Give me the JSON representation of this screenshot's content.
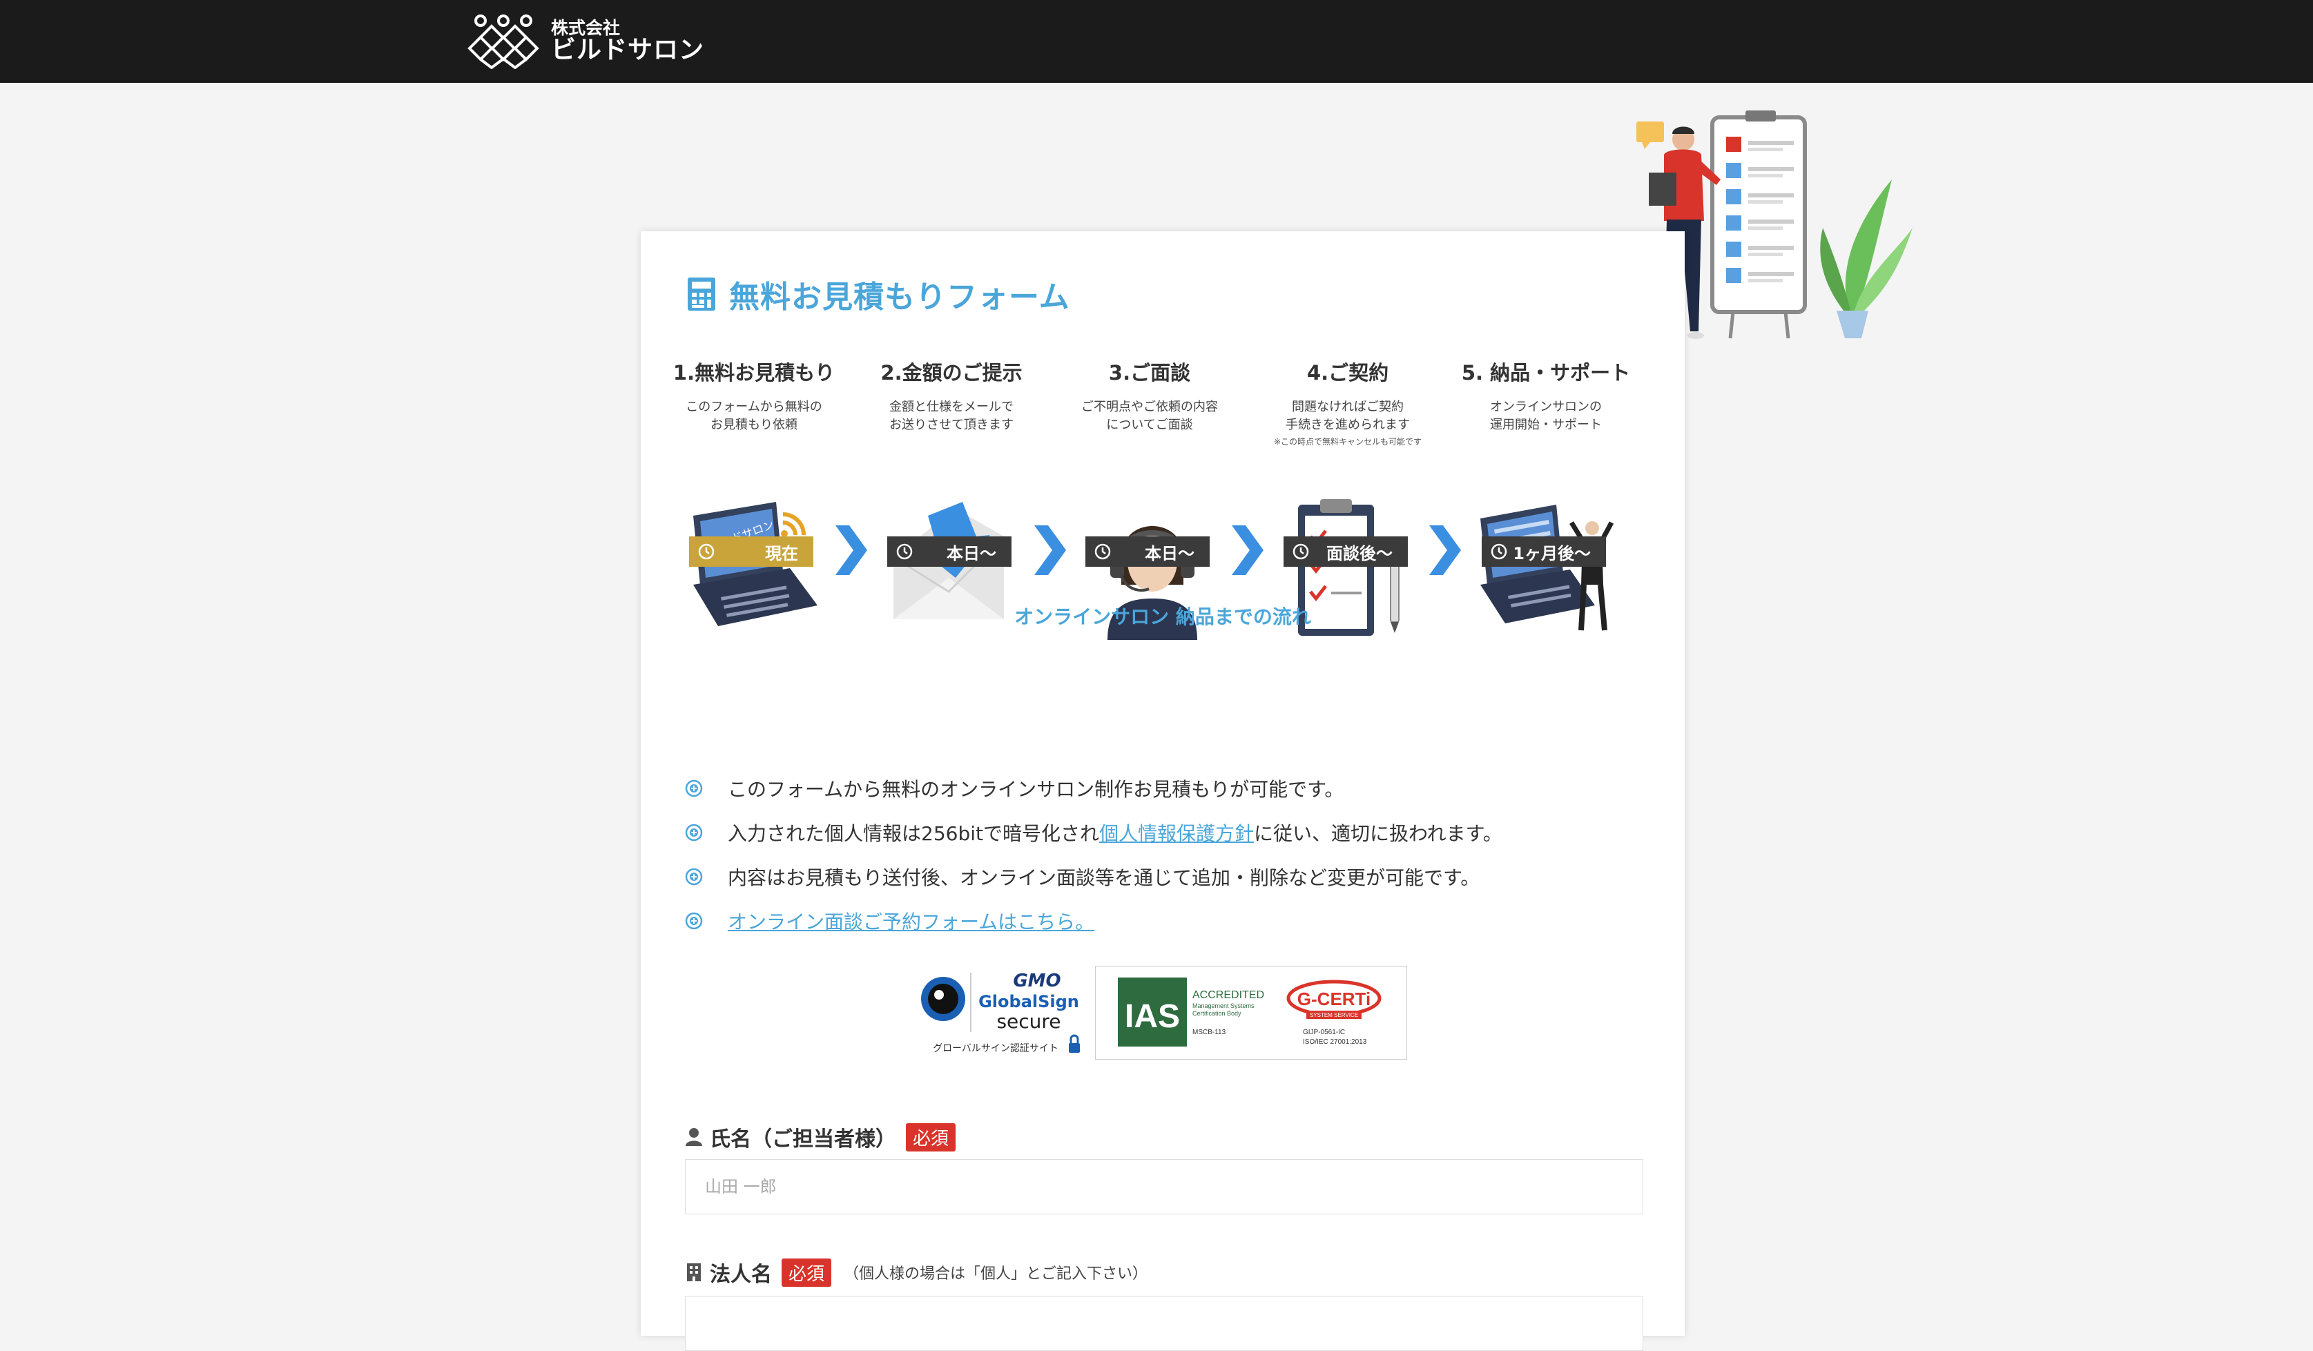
{
  "header": {
    "company_small": "株式会社",
    "company_name": "ビルドサロン",
    "logo_icon": "diamond-lattice-logo"
  },
  "form": {
    "title": "無料お見積もりフォーム",
    "title_icon": "calculator-icon",
    "accent": "#4aa6da",
    "steps": [
      {
        "title": "1.無料お見積もり",
        "desc": "このフォームから無料の\nお見積もり依頼",
        "note": "",
        "badge": "現在",
        "icon": "laptop-wifi-icon"
      },
      {
        "title": "2.金額のご提示",
        "desc": "金額と仕様をメールで\nお送りさせて頂きます",
        "note": "",
        "badge": "本日〜",
        "icon": "envelope-arrow-icon"
      },
      {
        "title": "3.ご面談",
        "desc": "ご不明点やご依頼の内容\nについてご面談",
        "note": "",
        "badge": "本日〜",
        "icon": "headset-operator-icon"
      },
      {
        "title": "4.ご契約",
        "desc": "問題なければご契約\n手続きを進められます",
        "note": "※この時点で無料キャンセルも可能です",
        "badge": "面談後〜",
        "icon": "clipboard-pen-icon"
      },
      {
        "title": "5. 納品・サポート",
        "desc": "オンラインサロンの\n運用開始・サポート",
        "note": "",
        "badge": "1ヶ月後〜",
        "icon": "laptop-businessman-icon"
      }
    ],
    "flow_caption": "オンラインサロン 納品までの流れ",
    "notes": {
      "n1": "このフォームから無料のオンラインサロン制作お見積もりが可能です。",
      "n2_before": "入力された個人情報は256bitで暗号化され",
      "n2_link": "個人情報保護方針",
      "n2_after": "に従い、適切に扱われます。",
      "n3": "内容はお見積もり送付後、オンライン面談等を通じて追加・削除など変更が可能です。",
      "n4_link": "オンライン面談ご予約フォームはこちら。"
    },
    "seals": {
      "gmo_brand": "GMO",
      "gmo_name": "GlobalSign",
      "gmo_secure": "secure",
      "gmo_caption": "グローバルサイン認証サイト",
      "ias_logo": "IAS",
      "ias_accredited": "ACCREDITED",
      "ias_sub1": "Management Systems",
      "ias_sub2": "Certification Body",
      "ias_code": "MSCB-113",
      "gcert_logo": "G-CERTi",
      "gcert_sub": "SYSTEM SERVICE",
      "gcert_code1": "GIJP-0561-IC",
      "gcert_code2": "ISO/IEC 27001:2013"
    },
    "fields": {
      "name_label": "氏名（ご担当者様）",
      "name_required": "必須",
      "name_placeholder": "山田 一郎",
      "company_label": "法人名",
      "company_required": "必須",
      "company_hint": "（個人様の場合は「個人」とご記入下さい）"
    }
  }
}
